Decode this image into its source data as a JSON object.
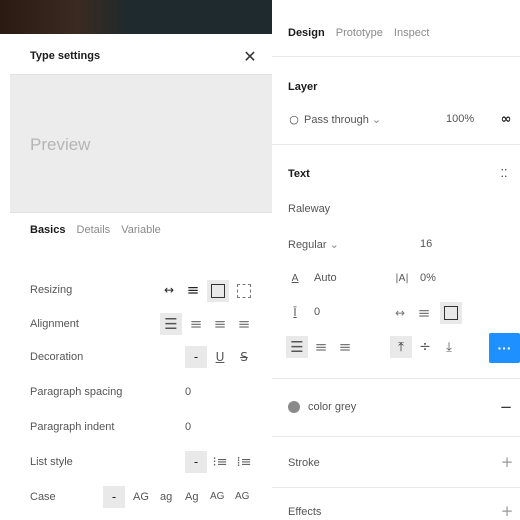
{
  "type_settings": {
    "title": "Type settings",
    "preview": "Preview",
    "tabs": [
      "Basics",
      "Details",
      "Variable"
    ],
    "rows": {
      "resizing": "Resizing",
      "alignment": "Alignment",
      "decoration": "Decoration",
      "decoration_none": "-",
      "paragraph_spacing": "Paragraph spacing",
      "paragraph_spacing_value": "0",
      "paragraph_indent": "Paragraph indent",
      "paragraph_indent_value": "0",
      "list_style": "List style",
      "list_style_none": "-",
      "case": "Case",
      "case_none": "-",
      "case_options": [
        "AG",
        "ag",
        "Ag",
        "AG",
        "AG"
      ]
    }
  },
  "design_panel": {
    "tabs": [
      "Design",
      "Prototype",
      "Inspect"
    ],
    "layer": {
      "title": "Layer",
      "blend_mode": "Pass through",
      "opacity": "100%"
    },
    "text": {
      "title": "Text",
      "font_family": "Raleway",
      "font_style": "Regular",
      "font_size": "16",
      "line_height": "Auto",
      "letter_spacing": "0%",
      "paragraph_spacing": "0",
      "more_label": "···"
    },
    "fill": {
      "style_name": "color grey",
      "swatch": "#8a8a8a",
      "remove": "−"
    },
    "stroke": {
      "title": "Stroke",
      "add": "+"
    },
    "effects": {
      "title": "Effects",
      "add": "+"
    }
  },
  "colors": {
    "accent": "#1e90ff"
  }
}
